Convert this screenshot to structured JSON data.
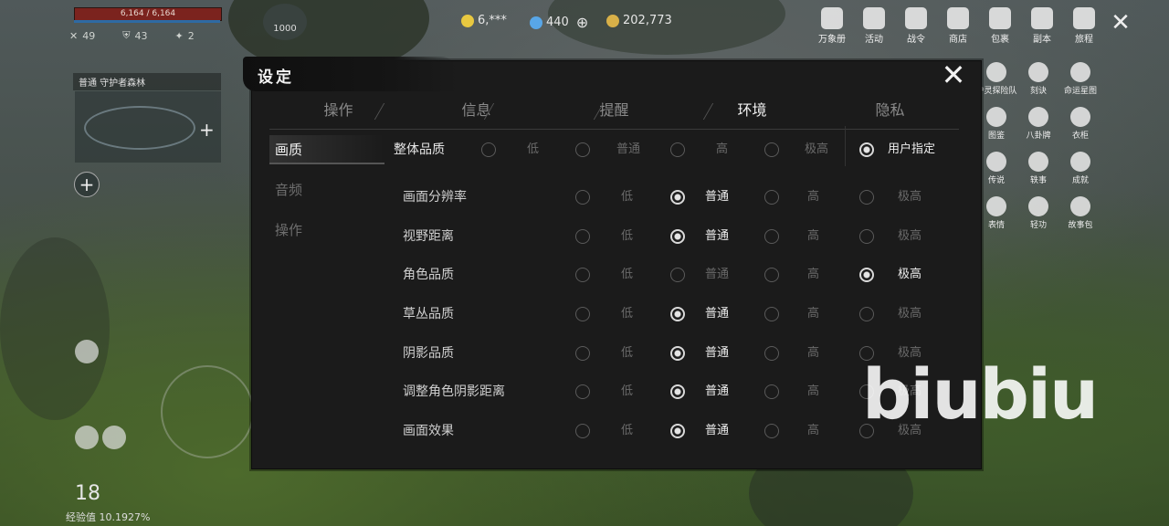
{
  "hud": {
    "hp_text": "6,164 / 6,164",
    "stats": [
      "49",
      "43",
      "2"
    ],
    "level_badge": "1000",
    "currency": [
      {
        "name": "gem",
        "value": "6,***",
        "color": "#e8c840"
      },
      {
        "name": "diamond",
        "value": "440",
        "color": "#58a6e8"
      },
      {
        "name": "coin",
        "value": "202,773",
        "color": "#d8b048"
      }
    ],
    "map_title": "普通  守护者森林",
    "level_number": "18",
    "exp_text": "经验值 10.1927%"
  },
  "top_menu": [
    {
      "label": "万象册",
      "icon": "book-icon"
    },
    {
      "label": "活动",
      "icon": "gift-icon"
    },
    {
      "label": "战令",
      "icon": "badge-icon"
    },
    {
      "label": "商店",
      "icon": "shop-icon"
    },
    {
      "label": "包裹",
      "icon": "bag-icon"
    },
    {
      "label": "副本",
      "icon": "dungeon-icon"
    },
    {
      "label": "旅程",
      "icon": "journey-icon"
    }
  ],
  "side_menu": [
    {
      "label": "护灵探险队",
      "icon": "explore-icon"
    },
    {
      "label": "刻诀",
      "icon": "skill-icon"
    },
    {
      "label": "命运星图",
      "icon": "star-icon"
    },
    {
      "label": "图鉴",
      "icon": "atlas-icon"
    },
    {
      "label": "八卦牌",
      "icon": "bagua-icon"
    },
    {
      "label": "衣柜",
      "icon": "wardrobe-icon"
    },
    {
      "label": "传说",
      "icon": "legend-icon"
    },
    {
      "label": "轶事",
      "icon": "story-icon"
    },
    {
      "label": "成就",
      "icon": "achievement-icon"
    },
    {
      "label": "表情",
      "icon": "emote-icon"
    },
    {
      "label": "轻功",
      "icon": "lightness-icon"
    },
    {
      "label": "故事包",
      "icon": "storybook-icon"
    }
  ],
  "dialog": {
    "title": "设定",
    "tabs": [
      "操作",
      "信息",
      "提醒",
      "环境",
      "隐私"
    ],
    "active_tab": "环境",
    "categories": [
      "画质",
      "音频",
      "操作"
    ],
    "active_category": "画质",
    "overall": {
      "label": "整体品质",
      "options": [
        "低",
        "普通",
        "高",
        "极高",
        "用户指定"
      ],
      "selected": "用户指定"
    },
    "option_labels": [
      "低",
      "普通",
      "高",
      "极高"
    ],
    "settings": [
      {
        "label": "画面分辨率",
        "selected": "普通"
      },
      {
        "label": "视野距离",
        "selected": "普通"
      },
      {
        "label": "角色品质",
        "selected": "极高"
      },
      {
        "label": "草丛品质",
        "selected": "普通"
      },
      {
        "label": "阴影品质",
        "selected": "普通"
      },
      {
        "label": "调整角色阴影距离",
        "selected": "普通"
      },
      {
        "label": "画面效果",
        "selected": "普通"
      }
    ]
  },
  "watermark": "biubiu"
}
